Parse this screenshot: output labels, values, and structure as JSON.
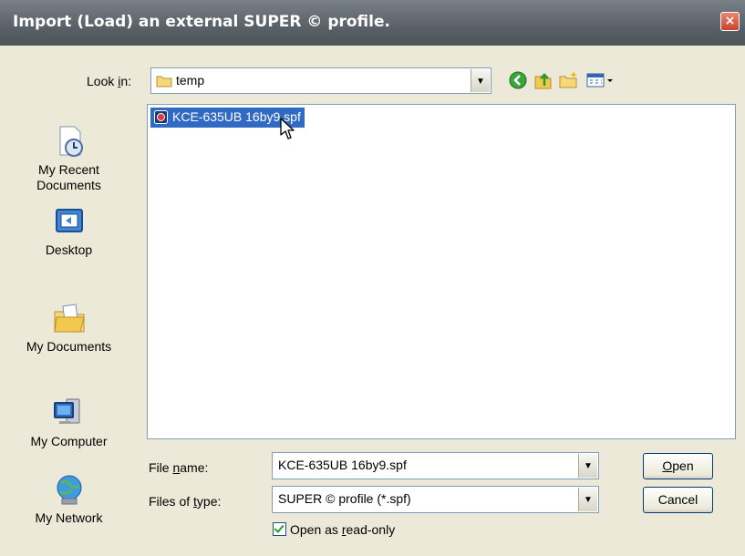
{
  "window": {
    "title": "Import (Load) an external SUPER © profile.",
    "close_symbol": "×"
  },
  "lookin": {
    "label": "Look in:",
    "value": "temp"
  },
  "places": [
    {
      "line1": "My Recent",
      "line2": "Documents",
      "icon": "recent-documents-icon"
    },
    {
      "line1": "Desktop",
      "line2": "",
      "icon": "desktop-icon"
    },
    {
      "line1": "My Documents",
      "line2": "",
      "icon": "my-documents-icon"
    },
    {
      "line1": "My Computer",
      "line2": "",
      "icon": "my-computer-icon"
    },
    {
      "line1": "My Network",
      "line2": "",
      "icon": "my-network-icon"
    }
  ],
  "files": [
    {
      "name": "KCE-635UB 16by9.spf",
      "selected": true
    }
  ],
  "filename": {
    "label": "File name:",
    "value": "KCE-635UB 16by9.spf"
  },
  "filetype": {
    "label": "Files of type:",
    "value": "SUPER © profile (*.spf)"
  },
  "readonly": {
    "label": "Open as read-only",
    "checked": true
  },
  "buttons": {
    "open": "Open",
    "cancel": "Cancel"
  },
  "arrow": "▼"
}
